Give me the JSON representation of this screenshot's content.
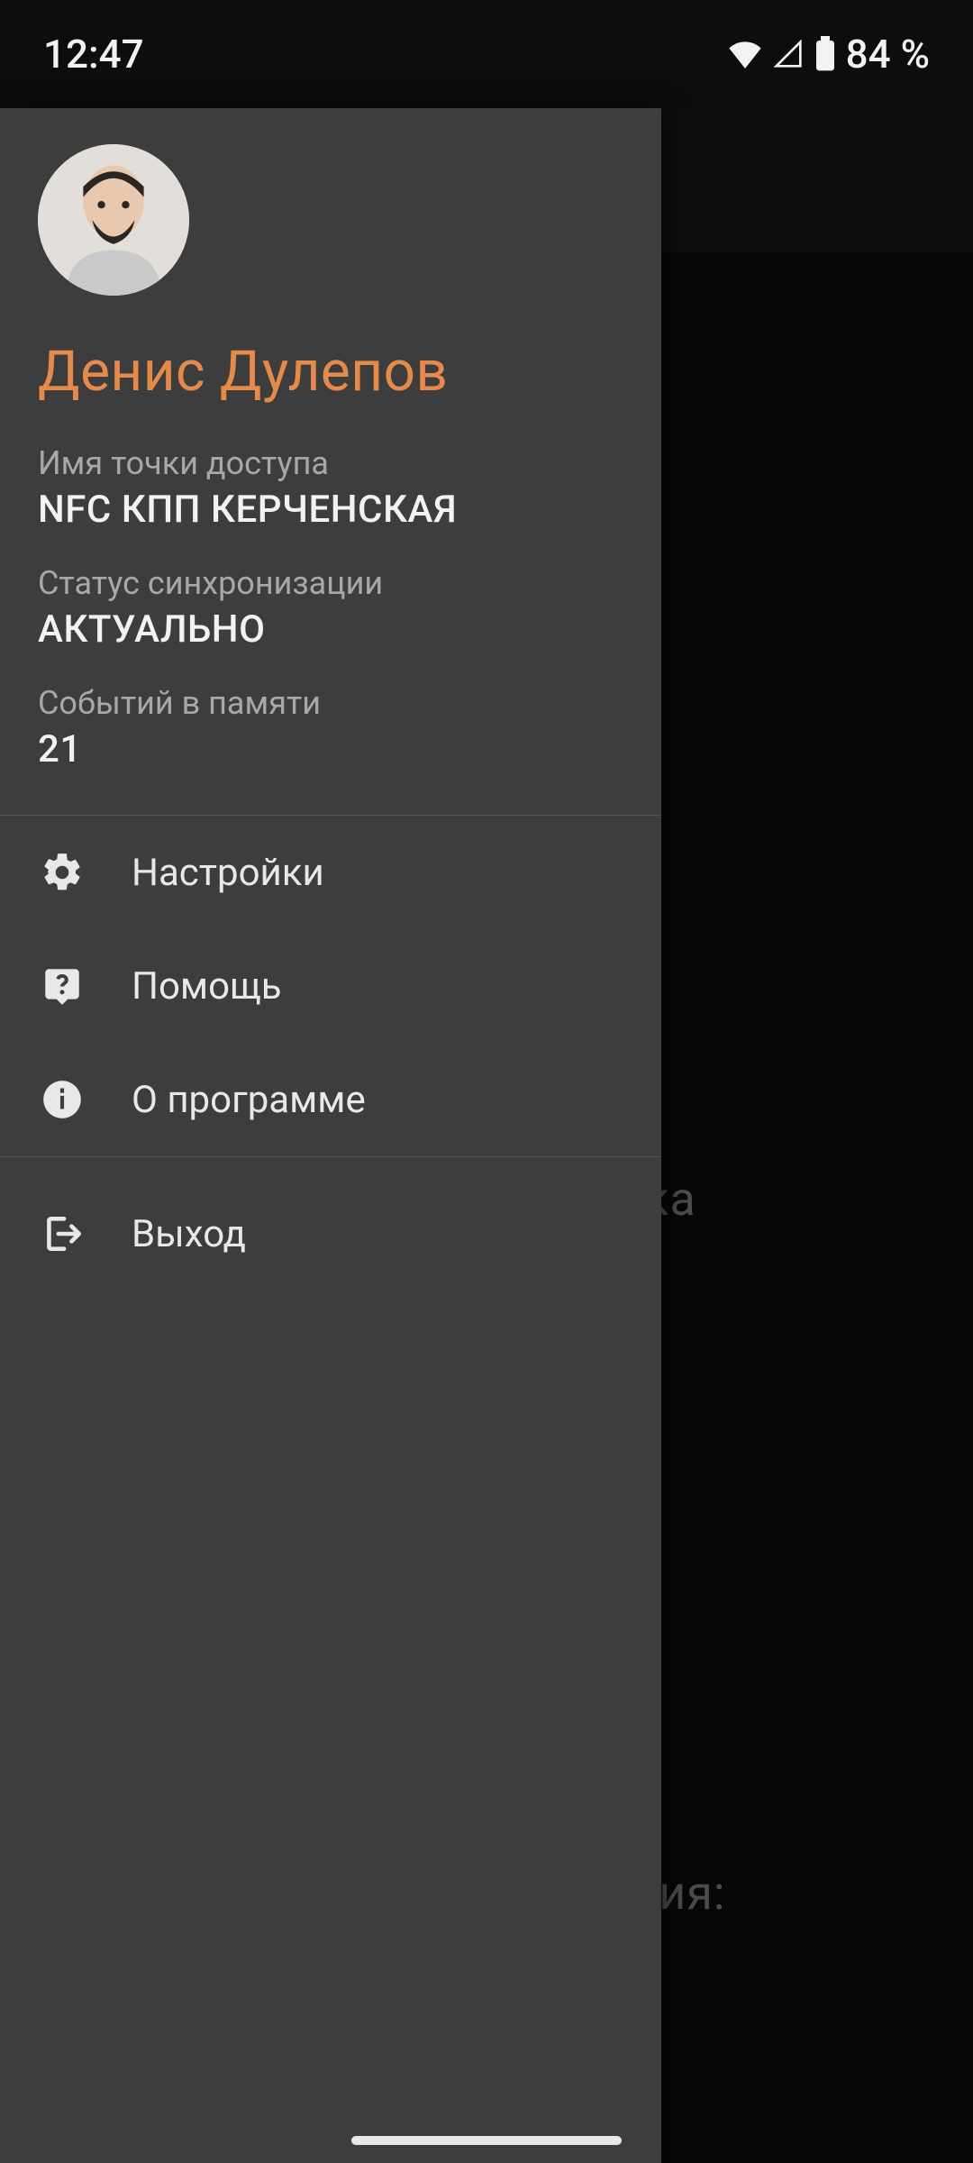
{
  "statusbar": {
    "time": "12:47",
    "battery_text": "84 %"
  },
  "main_behind": {
    "fragment_1": "дника",
    "fragment_2": "рация:"
  },
  "drawer": {
    "user_name": "Денис Дулепов",
    "info": [
      {
        "label": "Имя точки доступа",
        "value": "NFC КПП КЕРЧЕНСКАЯ"
      },
      {
        "label": "Статус синхронизации",
        "value": "АКТУАЛЬНО"
      },
      {
        "label": "Событий в памяти",
        "value": "21"
      }
    ],
    "menu_primary": [
      {
        "label": "Настройки"
      },
      {
        "label": "Помощь"
      },
      {
        "label": "О программе"
      }
    ],
    "menu_secondary": [
      {
        "label": "Выход"
      }
    ]
  }
}
